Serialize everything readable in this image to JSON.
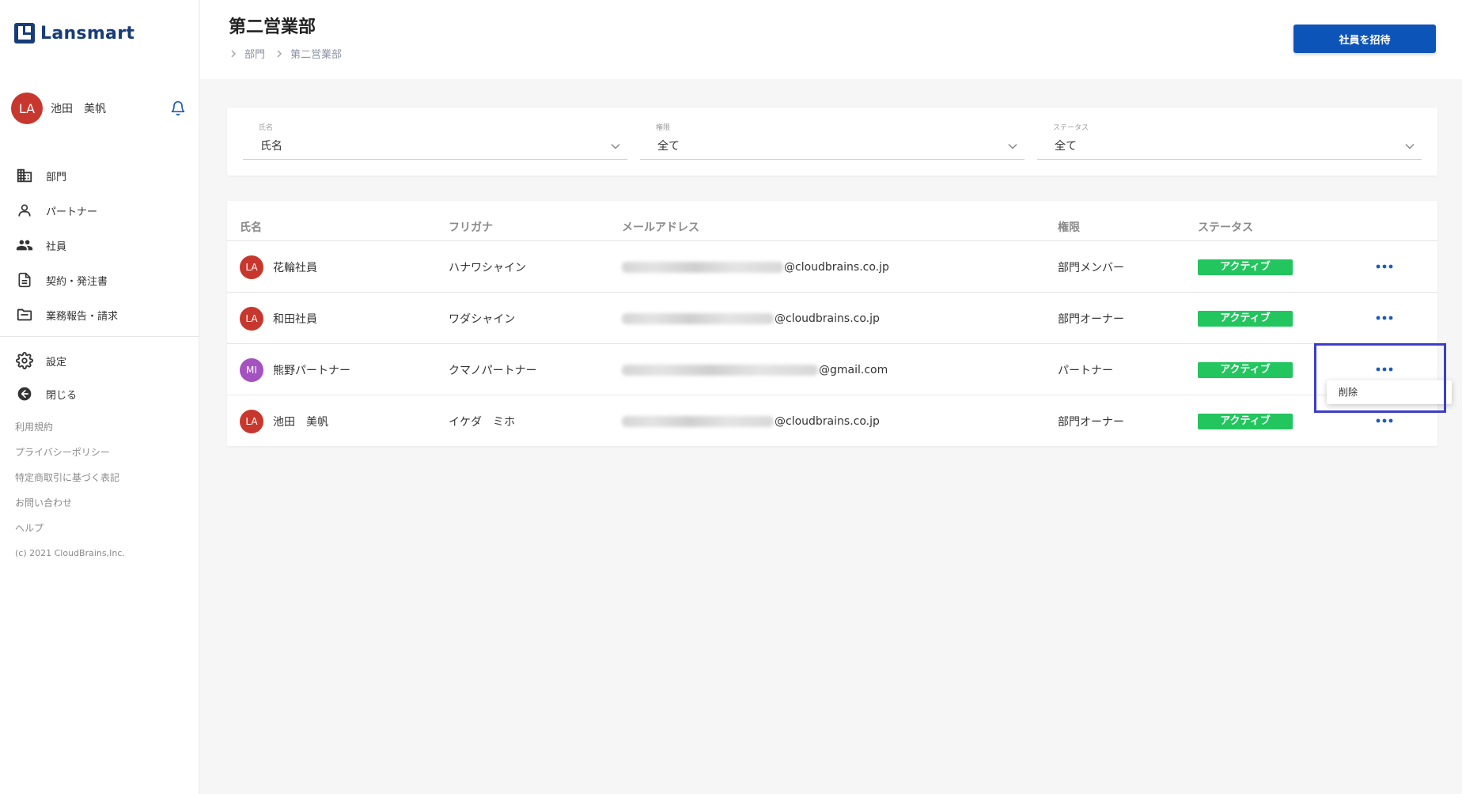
{
  "app": {
    "logo_text": "Lansmart",
    "brand_color": "#173c78",
    "accent_color": "#0d54b8"
  },
  "user": {
    "initials": "LA",
    "name": "池田　美帆",
    "avatar_color": "#c8372d"
  },
  "sidebar": {
    "items": [
      {
        "label": "部門",
        "icon": "building-icon"
      },
      {
        "label": "パートナー",
        "icon": "person-icon"
      },
      {
        "label": "社員",
        "icon": "people-icon"
      },
      {
        "label": "契約・発注書",
        "icon": "document-icon"
      },
      {
        "label": "業務報告・請求",
        "icon": "folder-icon"
      }
    ],
    "items2": [
      {
        "label": "設定",
        "icon": "gear-icon"
      },
      {
        "label": "閉じる",
        "icon": "arrow-left-circle-icon"
      }
    ],
    "links": [
      "利用規約",
      "プライバシーポリシー",
      "特定商取引に基づく表記",
      "お問い合わせ",
      "ヘルプ"
    ],
    "copyright": "(c) 2021 CloudBrains,Inc."
  },
  "header": {
    "title": "第二営業部",
    "breadcrumb": [
      "部門",
      "第二営業部"
    ],
    "invite_label": "社員を招待"
  },
  "filters": [
    {
      "label": "氏名",
      "value": "氏名"
    },
    {
      "label": "権限",
      "value": "全て"
    },
    {
      "label": "ステータス",
      "value": "全て"
    }
  ],
  "table": {
    "headers": [
      "氏名",
      "フリガナ",
      "メールアドレス",
      "権限",
      "ステータス"
    ],
    "rows": [
      {
        "initials": "LA",
        "avatar_color": "#c8372d",
        "name": "花輪社員",
        "kana": "ハナワシャイン",
        "email_domain": "@cloudbrains.co.jp",
        "role": "部門メンバー",
        "status": "アクティブ"
      },
      {
        "initials": "LA",
        "avatar_color": "#c8372d",
        "name": "和田社員",
        "kana": "ワダシャイン",
        "email_domain": "@cloudbrains.co.jp",
        "role": "部門オーナー",
        "status": "アクティブ"
      },
      {
        "initials": "MI",
        "avatar_color": "#a552c1",
        "name": "熊野パートナー",
        "kana": "クマノパートナー",
        "email_domain": "@gmail.com",
        "role": "パートナー",
        "status": "アクティブ"
      },
      {
        "initials": "LA",
        "avatar_color": "#c8372d",
        "name": "池田　美帆",
        "kana": "イケダ　ミホ",
        "email_domain": "@cloudbrains.co.jp",
        "role": "部門オーナー",
        "status": "アクティブ"
      }
    ],
    "status_color": "#22c55e"
  },
  "row_menu": {
    "items": [
      "削除"
    ]
  }
}
